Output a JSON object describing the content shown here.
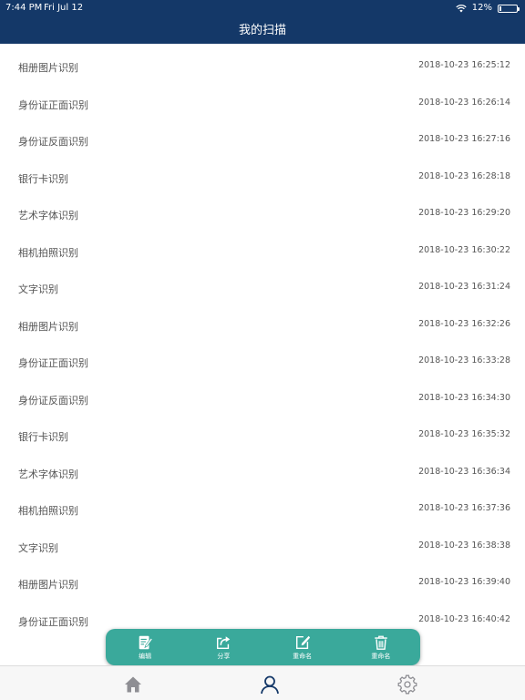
{
  "status_bar": {
    "time": "7:44 PM",
    "date": "Fri Jul 12",
    "battery_percent": "12%",
    "battery_level": 0.12
  },
  "header": {
    "title": "我的扫描"
  },
  "records": [
    {
      "name": "相册图片识别",
      "time": "2018-10-23 16:25:12"
    },
    {
      "name": "身份证正面识别",
      "time": "2018-10-23 16:26:14"
    },
    {
      "name": "身份证反面识别",
      "time": "2018-10-23 16:27:16"
    },
    {
      "name": "银行卡识别",
      "time": "2018-10-23 16:28:18"
    },
    {
      "name": "艺术字体识别",
      "time": "2018-10-23 16:29:20"
    },
    {
      "name": "相机拍照识别",
      "time": "2018-10-23 16:30:22"
    },
    {
      "name": "文字识别",
      "time": "2018-10-23 16:31:24"
    },
    {
      "name": "相册图片识别",
      "time": "2018-10-23 16:32:26"
    },
    {
      "name": "身份证正面识别",
      "time": "2018-10-23 16:33:28"
    },
    {
      "name": "身份证反面识别",
      "time": "2018-10-23 16:34:30"
    },
    {
      "name": "银行卡识别",
      "time": "2018-10-23 16:35:32"
    },
    {
      "name": "艺术字体识别",
      "time": "2018-10-23 16:36:34"
    },
    {
      "name": "相机拍照识别",
      "time": "2018-10-23 16:37:36"
    },
    {
      "name": "文字识别",
      "time": "2018-10-23 16:38:38"
    },
    {
      "name": "相册图片识别",
      "time": "2018-10-23 16:39:40"
    },
    {
      "name": "身份证正面识别",
      "time": "2018-10-23 16:40:42"
    }
  ],
  "toolbar": {
    "edit_label": "编辑",
    "share_label": "分享",
    "rename_label": "重命名",
    "delete_label": "重命名"
  },
  "tabbar": {
    "items": [
      {
        "icon": "home-icon"
      },
      {
        "icon": "user-icon",
        "selected": true
      },
      {
        "icon": "gear-icon"
      }
    ]
  },
  "colors": {
    "header_bg": "#143868",
    "toolbar_bg": "#3aa99b",
    "tab_selected": "#143868",
    "tab_inactive": "#8e8e93"
  }
}
